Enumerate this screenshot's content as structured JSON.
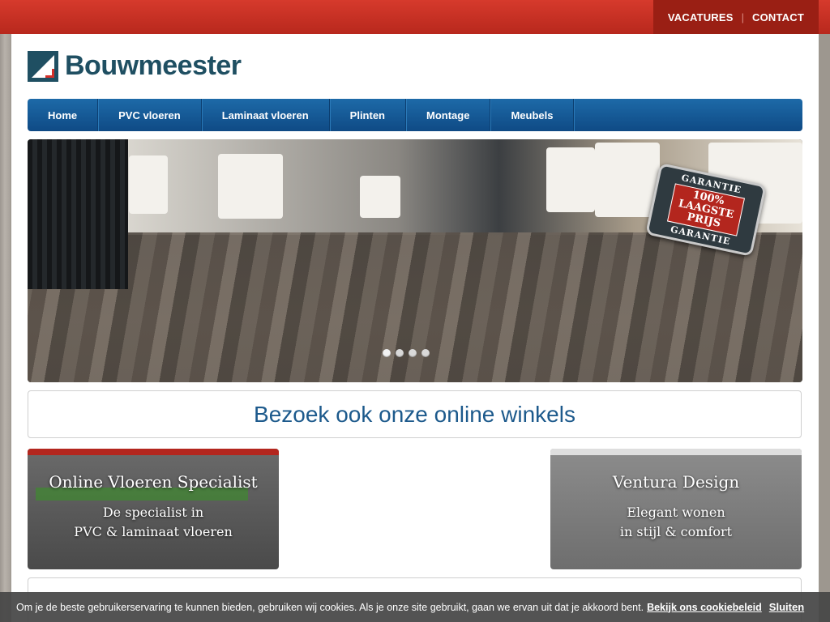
{
  "top_nav": {
    "vacatures": "VACATURES",
    "separator": "|",
    "contact": "CONTACT"
  },
  "logo": {
    "text": "Bouwmeester",
    "icon": "bouwmeester-logo-icon"
  },
  "main_nav": {
    "items": [
      "Home",
      "PVC vloeren",
      "Laminaat vloeren",
      "Plinten",
      "Montage",
      "Meubels"
    ]
  },
  "hero": {
    "badge": {
      "top": "GARANTIE",
      "line1": "100%",
      "line2": "LAAGSTE",
      "line3": "PRIJS",
      "bottom": "GARANTIE"
    },
    "slides_count": 4,
    "active_slide": 1
  },
  "banner": {
    "title": "Bezoek ook onze online winkels"
  },
  "shops": [
    {
      "title": "Online Vloeren Specialist",
      "line1": "De specialist in",
      "line2": "PVC & laminaat vloeren"
    },
    {
      "title": "Ventura Design",
      "line1": "Elegant wonen",
      "line2": "in stijl & comfort"
    }
  ],
  "cookie": {
    "message": "Om je de beste gebruikerservaring te kunnen bieden, gebruiken wij cookies. Als je onze site gebruikt, gaan we ervan uit dat je akkoord bent.",
    "link": "Bekijk ons cookiebeleid",
    "close": "Sluiten"
  },
  "colors": {
    "topbar": "#c8342a",
    "nav": "#165a98",
    "logo": "#1f4f62",
    "banner_text": "#1d5a8c"
  }
}
